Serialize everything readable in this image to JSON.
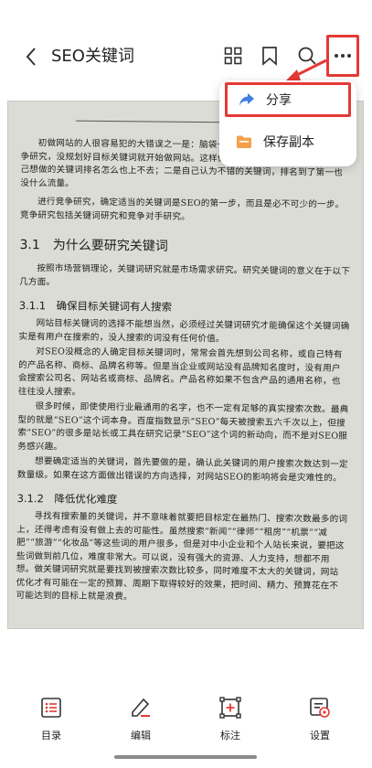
{
  "header": {
    "title": "SEO关键词",
    "icons": [
      "back-arrow-icon",
      "grid-icon",
      "bookmark-icon",
      "search-icon",
      "more-icon"
    ]
  },
  "menu": {
    "share_label": "分享",
    "save_copy_label": "保存副本",
    "highlight_color": "#e53935",
    "share_icon_color": "#3f7fe0",
    "save_icon_color": "#f4a04a"
  },
  "document": {
    "intro_p1": "初做网站的人很容易犯的大错误之一是：脑袋一拍就贸然进入某个领域，跳过竞争研究，没规划好目标关键词就开始做网站。这样做常常会导致两个结果：一是自己想做的关键词排名怎么也上不去；二是自己认为不错的关键词，排名到了第一也没什么流量。",
    "intro_p2": "进行竞争研究，确定适当的关键词是SEO的第一步，而且是必不可少的一步。竞争研究包括关键词研究和竞争对手研究。",
    "h_3_1": "3.1　为什么要研究关键词",
    "p_3_1": "按照市场营销理论，关键词研究就是市场需求研究。研究关键词的意义在于以下几方面。",
    "h_3_1_1": "3.1.1　确保目标关键词有人搜索",
    "p_3_1_1a": "网站目标关键词的选择不能想当然，必须经过关键词研究才能确保这个关键词确实是有用户在搜索的，没人搜索的词没有任何价值。",
    "p_3_1_1b": "对SEO没概念的人确定目标关键词时，常常会首先想到公司名称，或自己特有的产品名称、商标、品牌名称等。但是当企业或网站没有品牌知名度时，没有用户会搜索公司名、网站名或商标、品牌名。产品名称如果不包含产品的通用名称，也往往没人搜索。",
    "p_3_1_1c": "很多时候，即使使用行业最通用的名字，也不一定有足够的真实搜索次数。最典型的就是“SEO”这个词本身。百度指数显示“SEO”每天被搜索五六千次以上，但搜索“SEO”的很多是站长或工具在研究记录“SEO”这个词的新动向，而不是对SEO服务感兴趣。",
    "p_3_1_1d": "想要确定适当的关键词，首先要做的是，确认此关键词的用户搜索次数达到一定数量级。如果在这方面做出错误的方向选择，对网站SEO的影响将会是灾难性的。",
    "h_3_1_2": "3.1.2　降低优化难度",
    "p_3_1_2": "寻找有搜索量的关键词，并不意味着就要把目标定在最热门、搜索次数最多的词上，还得考虑有没有做上去的可能性。虽然搜索“新闻”“律师”“租房”“机票”“减肥”“旅游”“化妆品”等这些词的用户很多，但是对中小企业和个人站长来说，要把这些词做到前几位，难度非常大。可以说，没有强大的资源、人力支持，想都不用想。做关键词研究就是要找到被搜索次数比较多，同时难度不太大的关键词，网站优化才有可能在一定的预算、周期下取得较好的效果，把时间、精力、预算花在不可能达到的目标上就是浪费。"
  },
  "toolbar": {
    "catalog_label": "目录",
    "edit_label": "编辑",
    "annotate_label": "标注",
    "settings_label": "设置",
    "accent_color": "#e53935"
  }
}
